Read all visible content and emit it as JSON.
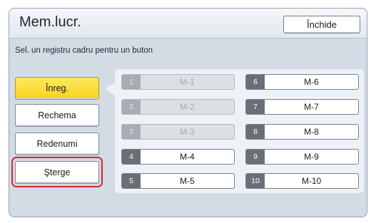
{
  "header": {
    "title": "Mem.lucr.",
    "close_label": "Închide"
  },
  "instruction": "Sel. un registru cadru pentru un buton",
  "actions": [
    {
      "label": "Înreg.",
      "active": true,
      "highlighted": false
    },
    {
      "label": "Rechema",
      "active": false,
      "highlighted": false
    },
    {
      "label": "Redenumi",
      "active": false,
      "highlighted": false
    },
    {
      "label": "Şterge",
      "active": false,
      "highlighted": true
    }
  ],
  "slots": [
    {
      "num": "1",
      "label": "M-1",
      "enabled": false
    },
    {
      "num": "2",
      "label": "M-2",
      "enabled": false
    },
    {
      "num": "3",
      "label": "M-3",
      "enabled": false
    },
    {
      "num": "4",
      "label": "M-4",
      "enabled": true
    },
    {
      "num": "5",
      "label": "M-5",
      "enabled": true
    },
    {
      "num": "6",
      "label": "M-6",
      "enabled": true
    },
    {
      "num": "7",
      "label": "M-7",
      "enabled": true
    },
    {
      "num": "8",
      "label": "M-8",
      "enabled": true
    },
    {
      "num": "9",
      "label": "M-9",
      "enabled": true
    },
    {
      "num": "10",
      "label": "M-10",
      "enabled": true
    }
  ],
  "colors": {
    "active_button": "#f6d41a",
    "highlight_ring": "#d6262f",
    "frame_background": "#d3dbe4"
  }
}
